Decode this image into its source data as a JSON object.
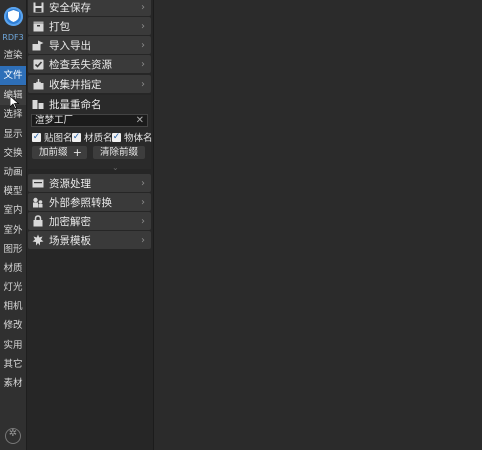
{
  "brand": "RDF3",
  "tabs": [
    "渲染",
    "文件",
    "编辑",
    "选择",
    "显示",
    "交换",
    "动画",
    "模型",
    "室内",
    "室外",
    "图形",
    "材质",
    "灯光",
    "相机",
    "修改",
    "实用",
    "其它",
    "素材"
  ],
  "active_tab": "文件",
  "sections_top": [
    {
      "label": "安全保存",
      "icon": "save-icon"
    },
    {
      "label": "打包",
      "icon": "package-icon"
    },
    {
      "label": "导入导出",
      "icon": "import-export-icon"
    },
    {
      "label": "检查丢失资源",
      "icon": "check-icon"
    },
    {
      "label": "收集并指定",
      "icon": "collect-icon"
    }
  ],
  "batch_rename": {
    "title": "批量重命名",
    "input_value": "渲梦工厂",
    "checkboxes": [
      {
        "label": "贴图名",
        "checked": true
      },
      {
        "label": "材质名",
        "checked": true
      },
      {
        "label": "物体名",
        "checked": true
      }
    ],
    "add_prefix": "加前缀",
    "clear_prefix": "清除前缀"
  },
  "sections_bottom": [
    {
      "label": "资源处理",
      "icon": "resource-icon"
    },
    {
      "label": "外部参照转换",
      "icon": "xref-icon"
    },
    {
      "label": "加密解密",
      "icon": "lock-icon"
    },
    {
      "label": "场景模板",
      "icon": "template-icon"
    }
  ]
}
